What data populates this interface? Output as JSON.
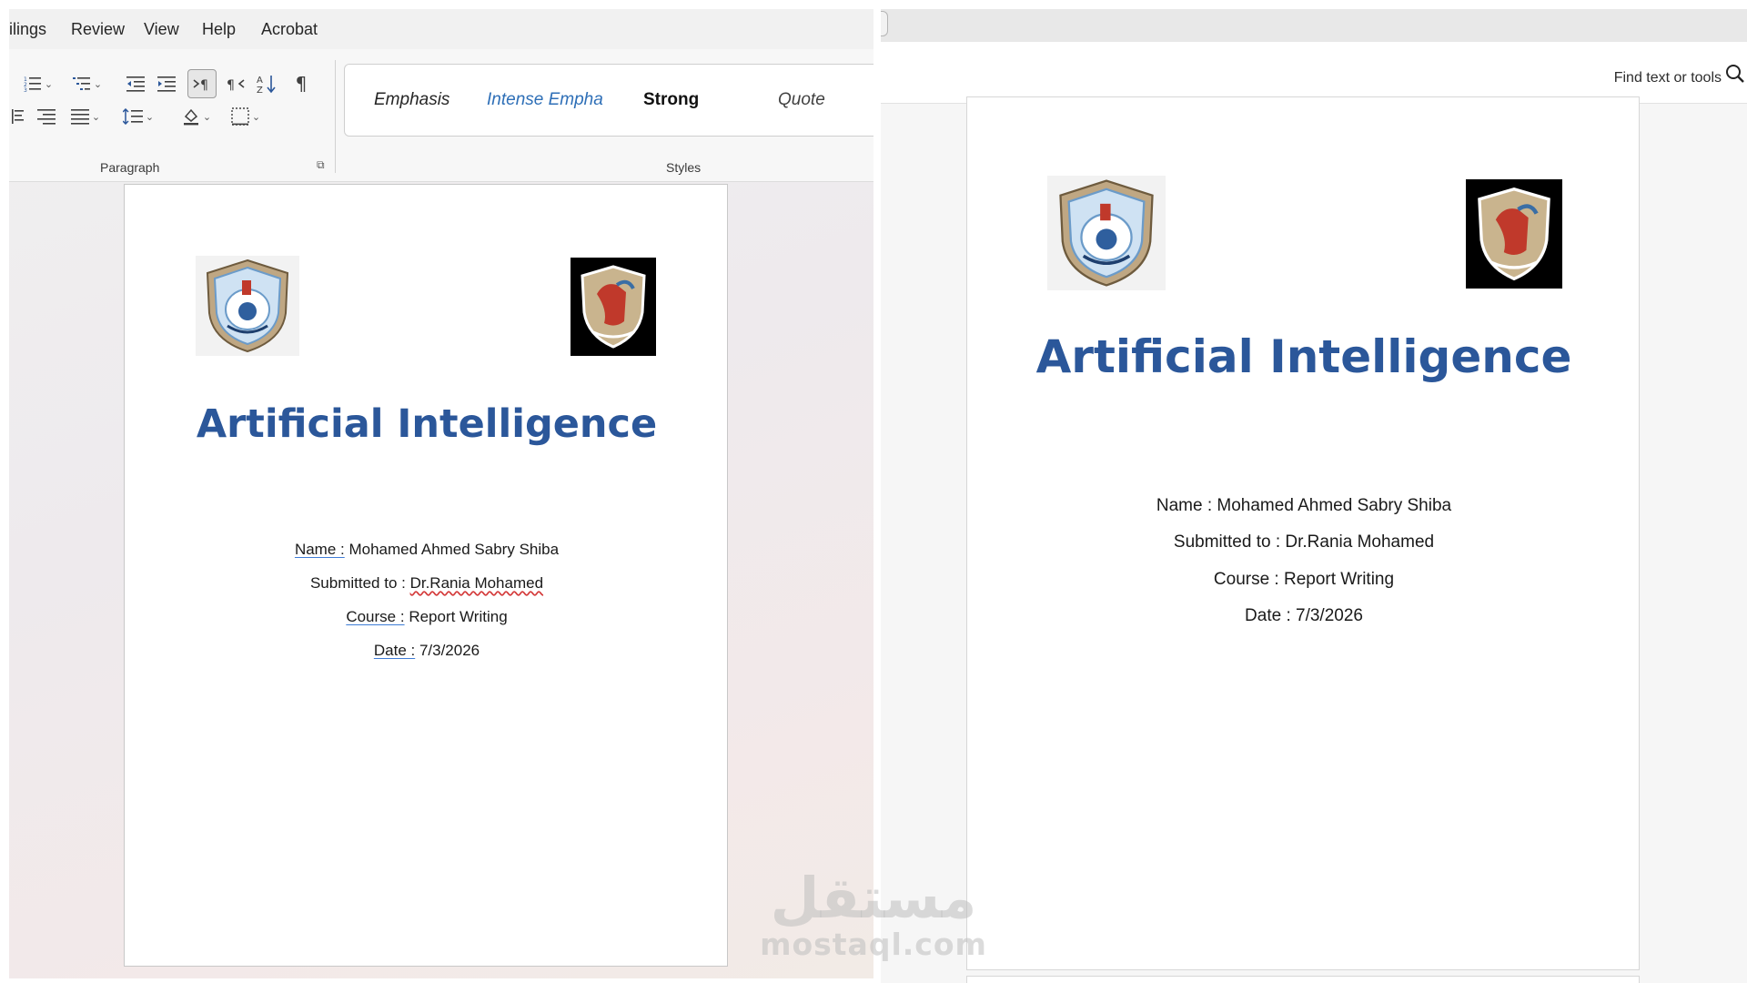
{
  "word": {
    "menu_tabs": [
      "ilings",
      "Review",
      "View",
      "Help",
      "Acrobat"
    ],
    "ribbon": {
      "paragraph_label": "Paragraph",
      "styles_label": "Styles",
      "show_marks_glyph": "¶",
      "styles": [
        {
          "label": "Emphasis"
        },
        {
          "label": "Intense Empha"
        },
        {
          "label": "Strong"
        },
        {
          "label": "Quote"
        }
      ]
    },
    "document": {
      "title": "Artificial Intelligence",
      "lines": [
        {
          "label": "Name :",
          "value": "Mohamed Ahmed Sabry Shiba"
        },
        {
          "label": "Submitted to :",
          "value": "Dr.Rania Mohamed"
        },
        {
          "label": "Course :",
          "value": "Report Writing"
        },
        {
          "label": "Date :",
          "value": "7/3/2026"
        }
      ]
    }
  },
  "pdf": {
    "find_label": "Find text or tools",
    "document": {
      "title": "Artificial Intelligence",
      "lines": [
        "Name : Mohamed Ahmed Sabry Shiba",
        "Submitted to : Dr.Rania Mohamed",
        "Course : Report Writing",
        "Date : 7/3/2026"
      ]
    }
  },
  "watermark": {
    "arabic": "مستقل",
    "latin": "mostaql.com"
  },
  "colors": {
    "title_blue": "#2b579a",
    "styles_blue": "#2e6fb7",
    "underline_blue": "#3e7cd6",
    "spell_red": "#d43b3b"
  }
}
